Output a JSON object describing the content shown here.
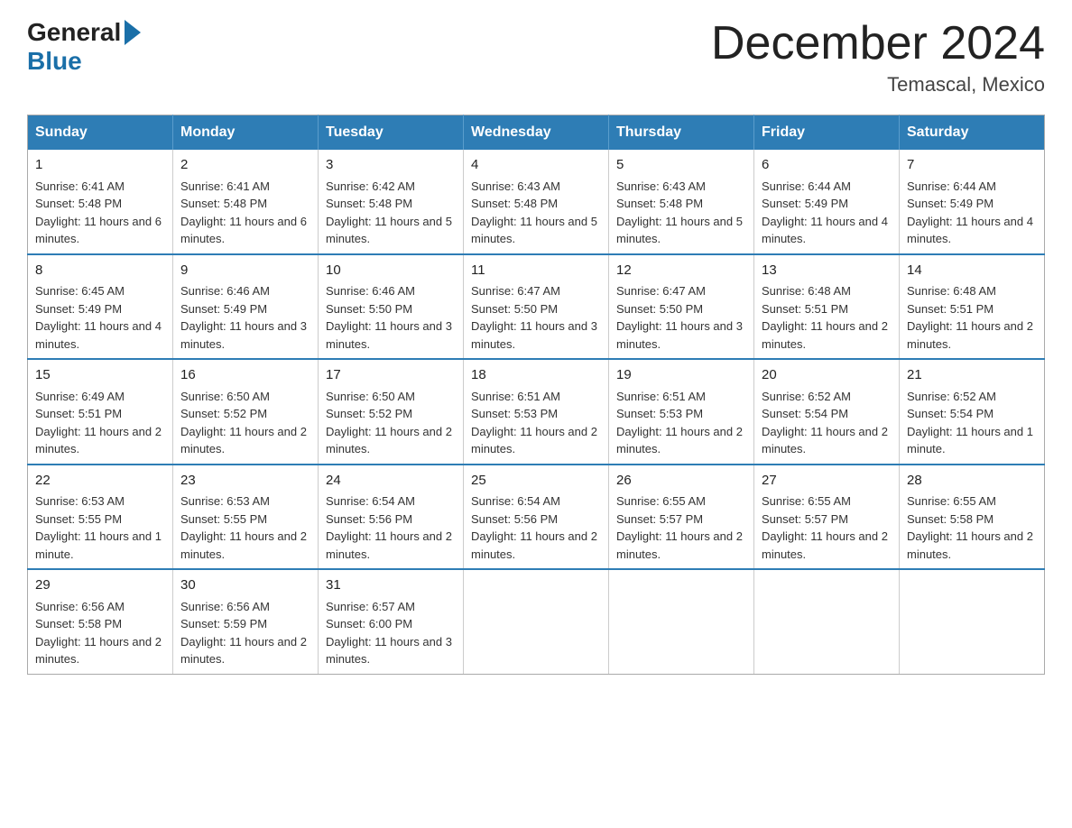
{
  "header": {
    "logo_general": "General",
    "logo_blue": "Blue",
    "month_title": "December 2024",
    "location": "Temascal, Mexico"
  },
  "days_of_week": [
    "Sunday",
    "Monday",
    "Tuesday",
    "Wednesday",
    "Thursday",
    "Friday",
    "Saturday"
  ],
  "weeks": [
    [
      {
        "day": "1",
        "sunrise": "6:41 AM",
        "sunset": "5:48 PM",
        "daylight": "11 hours and 6 minutes."
      },
      {
        "day": "2",
        "sunrise": "6:41 AM",
        "sunset": "5:48 PM",
        "daylight": "11 hours and 6 minutes."
      },
      {
        "day": "3",
        "sunrise": "6:42 AM",
        "sunset": "5:48 PM",
        "daylight": "11 hours and 5 minutes."
      },
      {
        "day": "4",
        "sunrise": "6:43 AM",
        "sunset": "5:48 PM",
        "daylight": "11 hours and 5 minutes."
      },
      {
        "day": "5",
        "sunrise": "6:43 AM",
        "sunset": "5:48 PM",
        "daylight": "11 hours and 5 minutes."
      },
      {
        "day": "6",
        "sunrise": "6:44 AM",
        "sunset": "5:49 PM",
        "daylight": "11 hours and 4 minutes."
      },
      {
        "day": "7",
        "sunrise": "6:44 AM",
        "sunset": "5:49 PM",
        "daylight": "11 hours and 4 minutes."
      }
    ],
    [
      {
        "day": "8",
        "sunrise": "6:45 AM",
        "sunset": "5:49 PM",
        "daylight": "11 hours and 4 minutes."
      },
      {
        "day": "9",
        "sunrise": "6:46 AM",
        "sunset": "5:49 PM",
        "daylight": "11 hours and 3 minutes."
      },
      {
        "day": "10",
        "sunrise": "6:46 AM",
        "sunset": "5:50 PM",
        "daylight": "11 hours and 3 minutes."
      },
      {
        "day": "11",
        "sunrise": "6:47 AM",
        "sunset": "5:50 PM",
        "daylight": "11 hours and 3 minutes."
      },
      {
        "day": "12",
        "sunrise": "6:47 AM",
        "sunset": "5:50 PM",
        "daylight": "11 hours and 3 minutes."
      },
      {
        "day": "13",
        "sunrise": "6:48 AM",
        "sunset": "5:51 PM",
        "daylight": "11 hours and 2 minutes."
      },
      {
        "day": "14",
        "sunrise": "6:48 AM",
        "sunset": "5:51 PM",
        "daylight": "11 hours and 2 minutes."
      }
    ],
    [
      {
        "day": "15",
        "sunrise": "6:49 AM",
        "sunset": "5:51 PM",
        "daylight": "11 hours and 2 minutes."
      },
      {
        "day": "16",
        "sunrise": "6:50 AM",
        "sunset": "5:52 PM",
        "daylight": "11 hours and 2 minutes."
      },
      {
        "day": "17",
        "sunrise": "6:50 AM",
        "sunset": "5:52 PM",
        "daylight": "11 hours and 2 minutes."
      },
      {
        "day": "18",
        "sunrise": "6:51 AM",
        "sunset": "5:53 PM",
        "daylight": "11 hours and 2 minutes."
      },
      {
        "day": "19",
        "sunrise": "6:51 AM",
        "sunset": "5:53 PM",
        "daylight": "11 hours and 2 minutes."
      },
      {
        "day": "20",
        "sunrise": "6:52 AM",
        "sunset": "5:54 PM",
        "daylight": "11 hours and 2 minutes."
      },
      {
        "day": "21",
        "sunrise": "6:52 AM",
        "sunset": "5:54 PM",
        "daylight": "11 hours and 1 minute."
      }
    ],
    [
      {
        "day": "22",
        "sunrise": "6:53 AM",
        "sunset": "5:55 PM",
        "daylight": "11 hours and 1 minute."
      },
      {
        "day": "23",
        "sunrise": "6:53 AM",
        "sunset": "5:55 PM",
        "daylight": "11 hours and 2 minutes."
      },
      {
        "day": "24",
        "sunrise": "6:54 AM",
        "sunset": "5:56 PM",
        "daylight": "11 hours and 2 minutes."
      },
      {
        "day": "25",
        "sunrise": "6:54 AM",
        "sunset": "5:56 PM",
        "daylight": "11 hours and 2 minutes."
      },
      {
        "day": "26",
        "sunrise": "6:55 AM",
        "sunset": "5:57 PM",
        "daylight": "11 hours and 2 minutes."
      },
      {
        "day": "27",
        "sunrise": "6:55 AM",
        "sunset": "5:57 PM",
        "daylight": "11 hours and 2 minutes."
      },
      {
        "day": "28",
        "sunrise": "6:55 AM",
        "sunset": "5:58 PM",
        "daylight": "11 hours and 2 minutes."
      }
    ],
    [
      {
        "day": "29",
        "sunrise": "6:56 AM",
        "sunset": "5:58 PM",
        "daylight": "11 hours and 2 minutes."
      },
      {
        "day": "30",
        "sunrise": "6:56 AM",
        "sunset": "5:59 PM",
        "daylight": "11 hours and 2 minutes."
      },
      {
        "day": "31",
        "sunrise": "6:57 AM",
        "sunset": "6:00 PM",
        "daylight": "11 hours and 3 minutes."
      },
      null,
      null,
      null,
      null
    ]
  ]
}
